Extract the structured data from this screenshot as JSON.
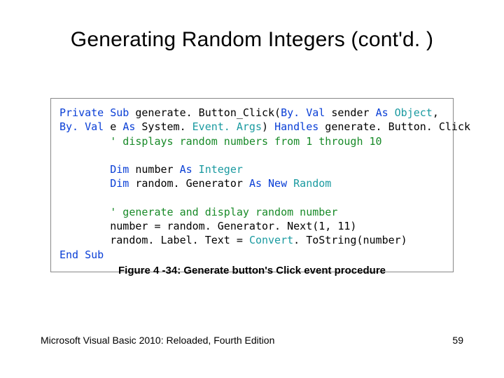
{
  "title": "Generating Random Integers (cont'd. )",
  "caption": "Figure 4 -34: Generate button's Click event procedure",
  "footer": {
    "left": "Microsoft Visual Basic 2010: Reloaded, Fourth Edition",
    "page": "59"
  },
  "code": {
    "l1": {
      "kw1": "Private Sub",
      "name": " generate. Button_Click(",
      "byval1": "By. Val",
      "arg1": " sender ",
      "as1": "As",
      "type1": " Object",
      "comma": ","
    },
    "l2": {
      "byval": "By. Val",
      "e": " e ",
      "as": "As",
      "sys": " System.",
      "ea": " Event. Args",
      "rp": ") ",
      "handles": "Handles",
      "rest": " generate. Button. Click"
    },
    "l3": {
      "c": "' displays random numbers from 1 through 10"
    },
    "l5": {
      "dim": "Dim",
      "var": " number ",
      "as": "As",
      "typ": " Integer"
    },
    "l6": {
      "dim": "Dim",
      "var": " random. Generator ",
      "as": "As New",
      "typ": " Random"
    },
    "l8": {
      "c": "' generate and display random number"
    },
    "l9": {
      "txt": "number = random. Generator. Next(1, 11)"
    },
    "l10": {
      "a": "random. Label. Text = ",
      "conv": "Convert",
      "b": ". ToString(number)"
    },
    "l11": {
      "end": "End Sub"
    }
  }
}
